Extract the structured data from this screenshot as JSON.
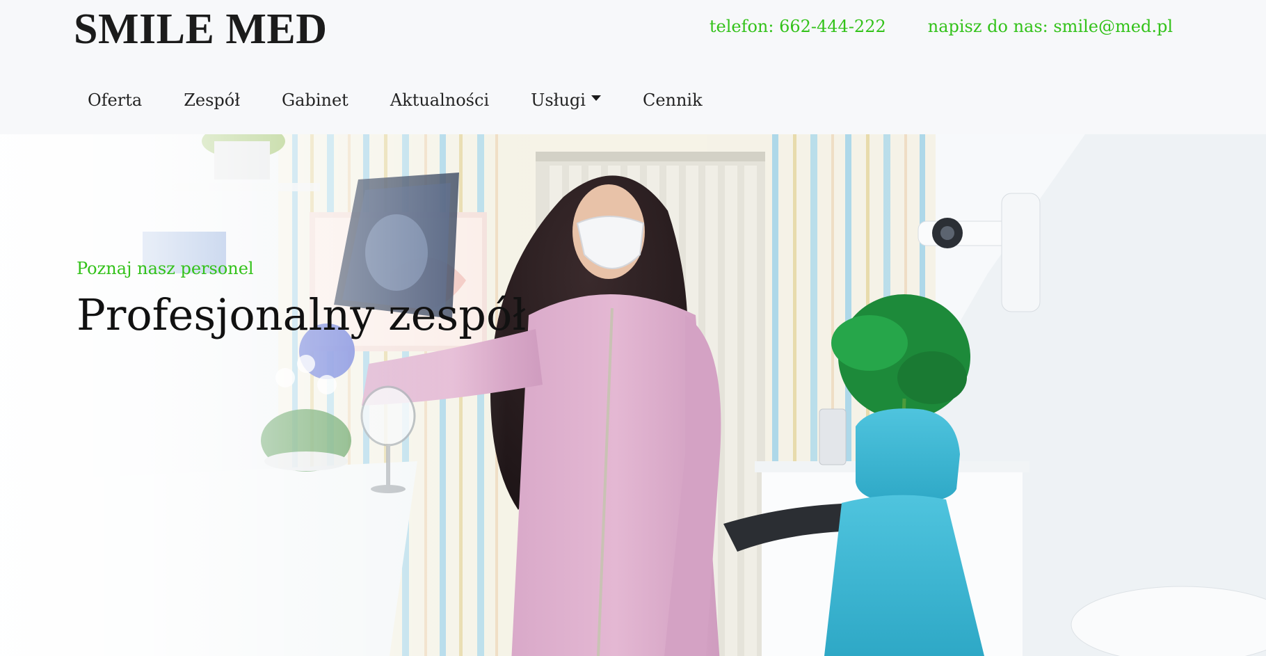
{
  "brand": {
    "name": "SMILE MED"
  },
  "contacts": {
    "phone": "telefon: 662-444-222",
    "email": "napisz do nas: smile@med.pl"
  },
  "nav": {
    "items": [
      {
        "label": "Oferta"
      },
      {
        "label": "Zespół"
      },
      {
        "label": "Gabinet"
      },
      {
        "label": "Aktualności"
      },
      {
        "label": "Usługi",
        "has_dropdown": true
      },
      {
        "label": "Cennik"
      }
    ]
  },
  "hero": {
    "eyebrow": "Poznaj nasz personel",
    "title": "Profesjonalny zespół",
    "image_description": "Dentist in pink uniform and face mask holding an X-ray in a dental office"
  },
  "colors": {
    "accent": "#33c21a",
    "text_dark": "#111111",
    "header_bg": "#f7f8fa"
  }
}
